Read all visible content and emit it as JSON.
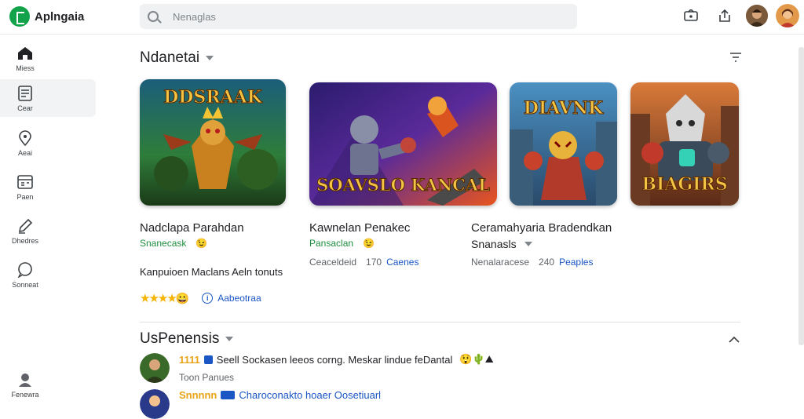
{
  "app": {
    "name": "Aplngaia"
  },
  "search": {
    "placeholder": "Nenaglas"
  },
  "sidebar": {
    "items": [
      {
        "label": "Miess"
      },
      {
        "label": "Cear"
      },
      {
        "label": "Aeai"
      },
      {
        "label": "Paen"
      },
      {
        "label": "Dhedres"
      },
      {
        "label": "Sonneat"
      },
      {
        "label": "Fenewra"
      }
    ]
  },
  "main": {
    "section_title": "Ndanetai",
    "cards": [
      {
        "title": "Nadclapa Parahdan",
        "sub_label": "Snanecask",
        "sub_emoji": "😉",
        "description": "Kanpuioen Maclans Aeln tonuts",
        "stars": "★★★★",
        "stars_emoji": "😀",
        "link_label": "Aabeotraa",
        "banner_text": "DDSRAAK"
      },
      {
        "title": "Kawnelan Penakec",
        "sub_label": "Pansaclan",
        "sub_emoji": "😉",
        "meta_grey": "Ceaceldeid",
        "meta_blue_prefix": "170",
        "meta_blue": "Caenes",
        "banner_text": "SOAVSLO KANCAL"
      },
      {
        "title": "Ceramahyaria Bradendkan",
        "sub_label": "Snanasls",
        "meta_grey": "Nenalaracese",
        "meta_blue_prefix": "240",
        "meta_blue": "Peaples",
        "banner_text": "DIAVNK"
      },
      {
        "banner_text": "BIAGIRS"
      }
    ],
    "updates_title": "UsPenensis",
    "updates": [
      {
        "rank": "1111",
        "text": "Seell Sockasen leeos corng. Meskar lindue feDantal",
        "meta": "Toon Panues",
        "emojis": "😲🌵⛰"
      },
      {
        "rank": "Snnnnn",
        "text": "Charoconakto hoaer Oosetiuarl"
      }
    ]
  },
  "colors": {
    "brand_green": "#12a34a",
    "link_blue": "#1a56c4",
    "star_gold": "#f5b400"
  }
}
